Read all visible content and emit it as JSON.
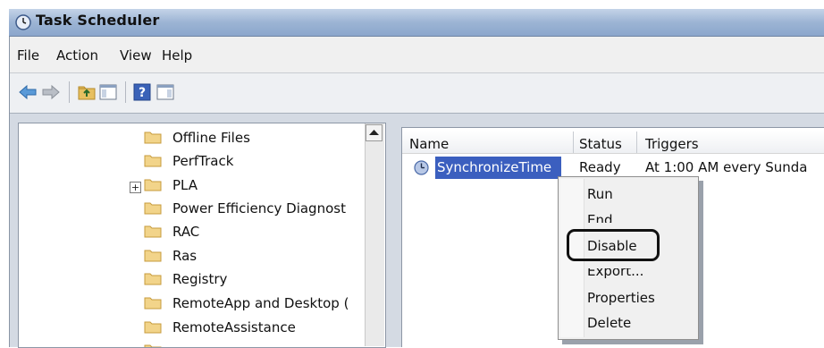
{
  "window": {
    "title": "Task Scheduler"
  },
  "menubar": {
    "items": [
      "File",
      "Action",
      "View",
      "Help"
    ]
  },
  "toolbar": {
    "icons": [
      "back-arrow-icon",
      "forward-arrow-icon",
      "up-folder-icon",
      "show-hide-console-tree-icon",
      "help-icon",
      "show-hide-action-pane-icon"
    ]
  },
  "tree": {
    "items": [
      {
        "label": "Offline Files",
        "expandable": false
      },
      {
        "label": "PerfTrack",
        "expandable": false
      },
      {
        "label": "PLA",
        "expandable": true,
        "expander": "+"
      },
      {
        "label": "Power Efficiency Diagnost",
        "expandable": false
      },
      {
        "label": "RAC",
        "expandable": false
      },
      {
        "label": "Ras",
        "expandable": false
      },
      {
        "label": "Registry",
        "expandable": false
      },
      {
        "label": "RemoteApp and Desktop (",
        "expandable": false
      },
      {
        "label": "RemoteAssistance",
        "expandable": false
      }
    ]
  },
  "tasklist": {
    "columns": [
      "Name",
      "Status",
      "Triggers"
    ],
    "rows": [
      {
        "name": "SynchronizeTime",
        "status": "Ready",
        "triggers": "At 1:00 AM every Sunda"
      }
    ]
  },
  "context_menu": {
    "items": [
      "Run",
      "End",
      "Disable",
      "Export...",
      "Properties",
      "Delete"
    ],
    "highlighted": "Disable"
  },
  "colors": {
    "selection": "#3b5fbf",
    "titlebar": "#9cb4d4"
  }
}
